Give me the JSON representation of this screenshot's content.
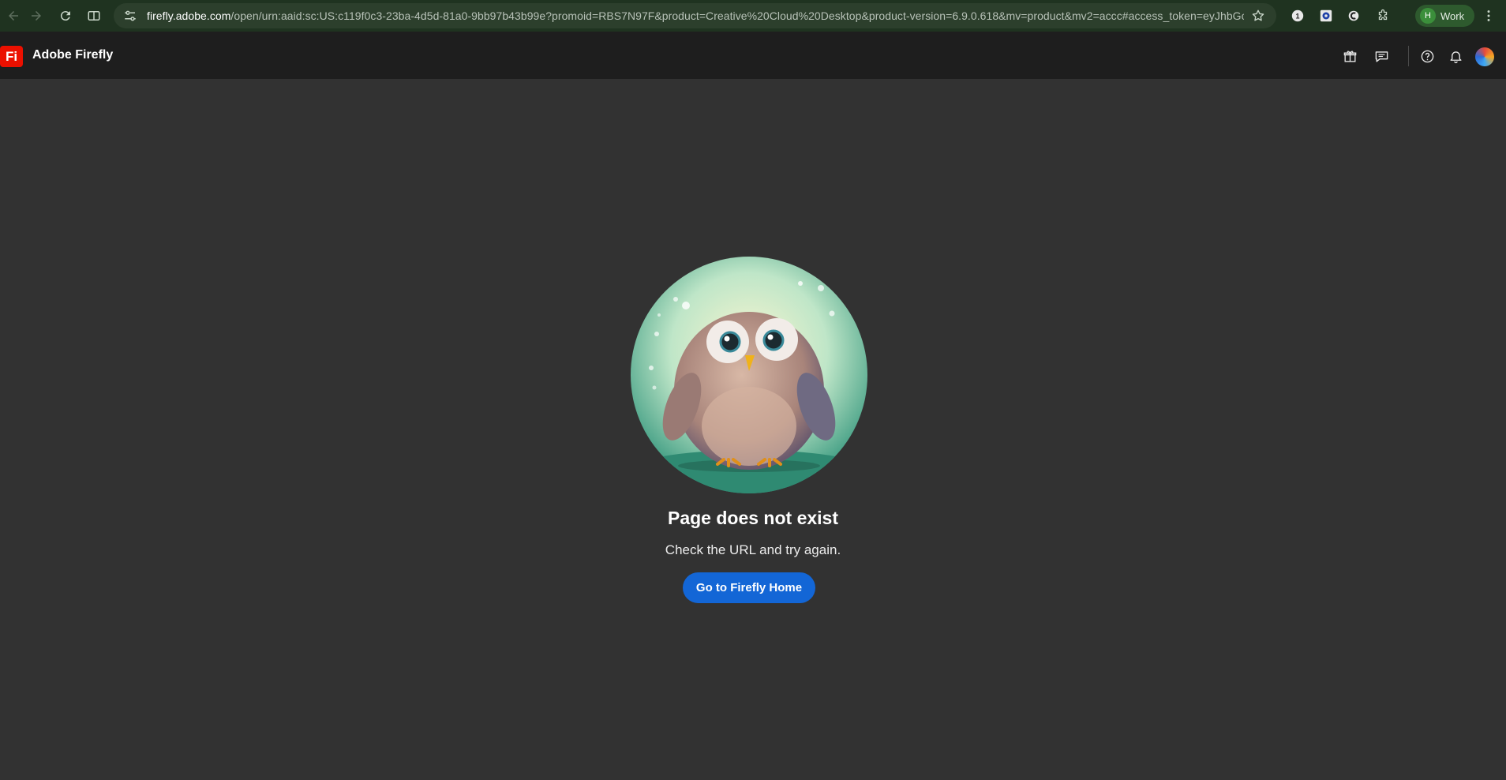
{
  "browser": {
    "url_host": "firefly.adobe.com",
    "url_rest": "/open/urn:aaid:sc:US:c119f0c3-23ba-4d5d-81a0-9bb97b43b99e?promoid=RBS7N97F&product=Creative%20Cloud%20Desktop&product-version=6.9.0.618&mv=product&mv2=accc#access_token=eyJhbGc...",
    "profile_initial": "H",
    "profile_label": "Work",
    "extension_1_label": "1"
  },
  "app": {
    "logo_text": "Fi",
    "title": "Adobe Firefly"
  },
  "error": {
    "title": "Page does not exist",
    "subtitle": "Check the URL and try again.",
    "button_label": "Go to Firefly Home"
  },
  "colors": {
    "accent": "#1366d6",
    "logo_red": "#eb1000",
    "background": "#323232"
  }
}
